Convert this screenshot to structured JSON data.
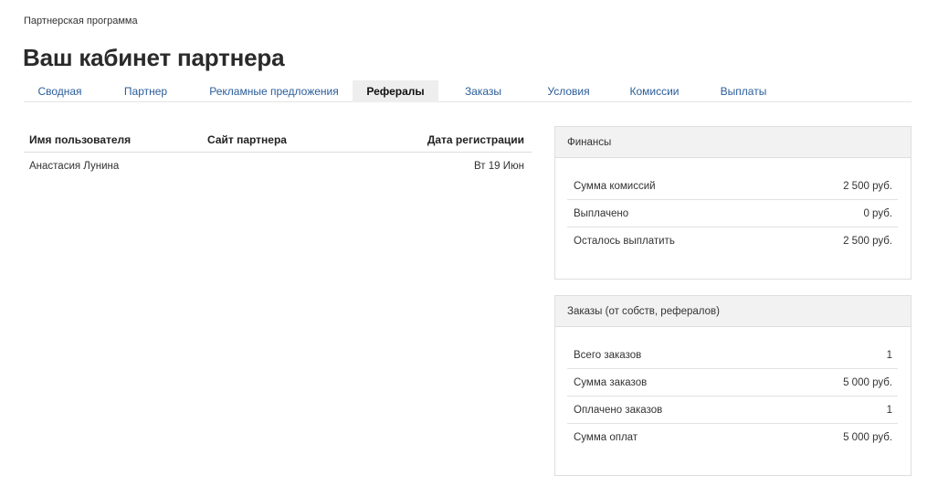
{
  "breadcrumb": "Партнерская программа",
  "title": "Ваш кабинет партнера",
  "tabs": [
    {
      "label": "Сводная"
    },
    {
      "label": "Партнер"
    },
    {
      "label": "Рекламные предложения"
    },
    {
      "label": "Рефералы",
      "active": true
    },
    {
      "label": "Заказы"
    },
    {
      "label": "Условия"
    },
    {
      "label": "Комиссии"
    },
    {
      "label": "Выплаты"
    }
  ],
  "referrals": {
    "headers": {
      "user": "Имя пользователя",
      "site": "Сайт партнера",
      "date": "Дата регистрации"
    },
    "rows": [
      {
        "user": "Анастасия Лунина",
        "site": "",
        "date": "Вт 19 Июн"
      }
    ]
  },
  "finances": {
    "title": "Финансы",
    "rows": [
      {
        "label": "Сумма комиссий",
        "value": "2 500 руб."
      },
      {
        "label": "Выплачено",
        "value": "0 руб."
      },
      {
        "label": "Осталось выплатить",
        "value": "2 500 руб."
      }
    ]
  },
  "orders": {
    "title": "Заказы (от собств, рефералов)",
    "rows": [
      {
        "label": "Всего заказов",
        "value": "1"
      },
      {
        "label": "Сумма заказов",
        "value": "5 000 руб."
      },
      {
        "label": "Оплачено заказов",
        "value": "1"
      },
      {
        "label": "Сумма оплат",
        "value": "5 000 руб."
      }
    ]
  }
}
